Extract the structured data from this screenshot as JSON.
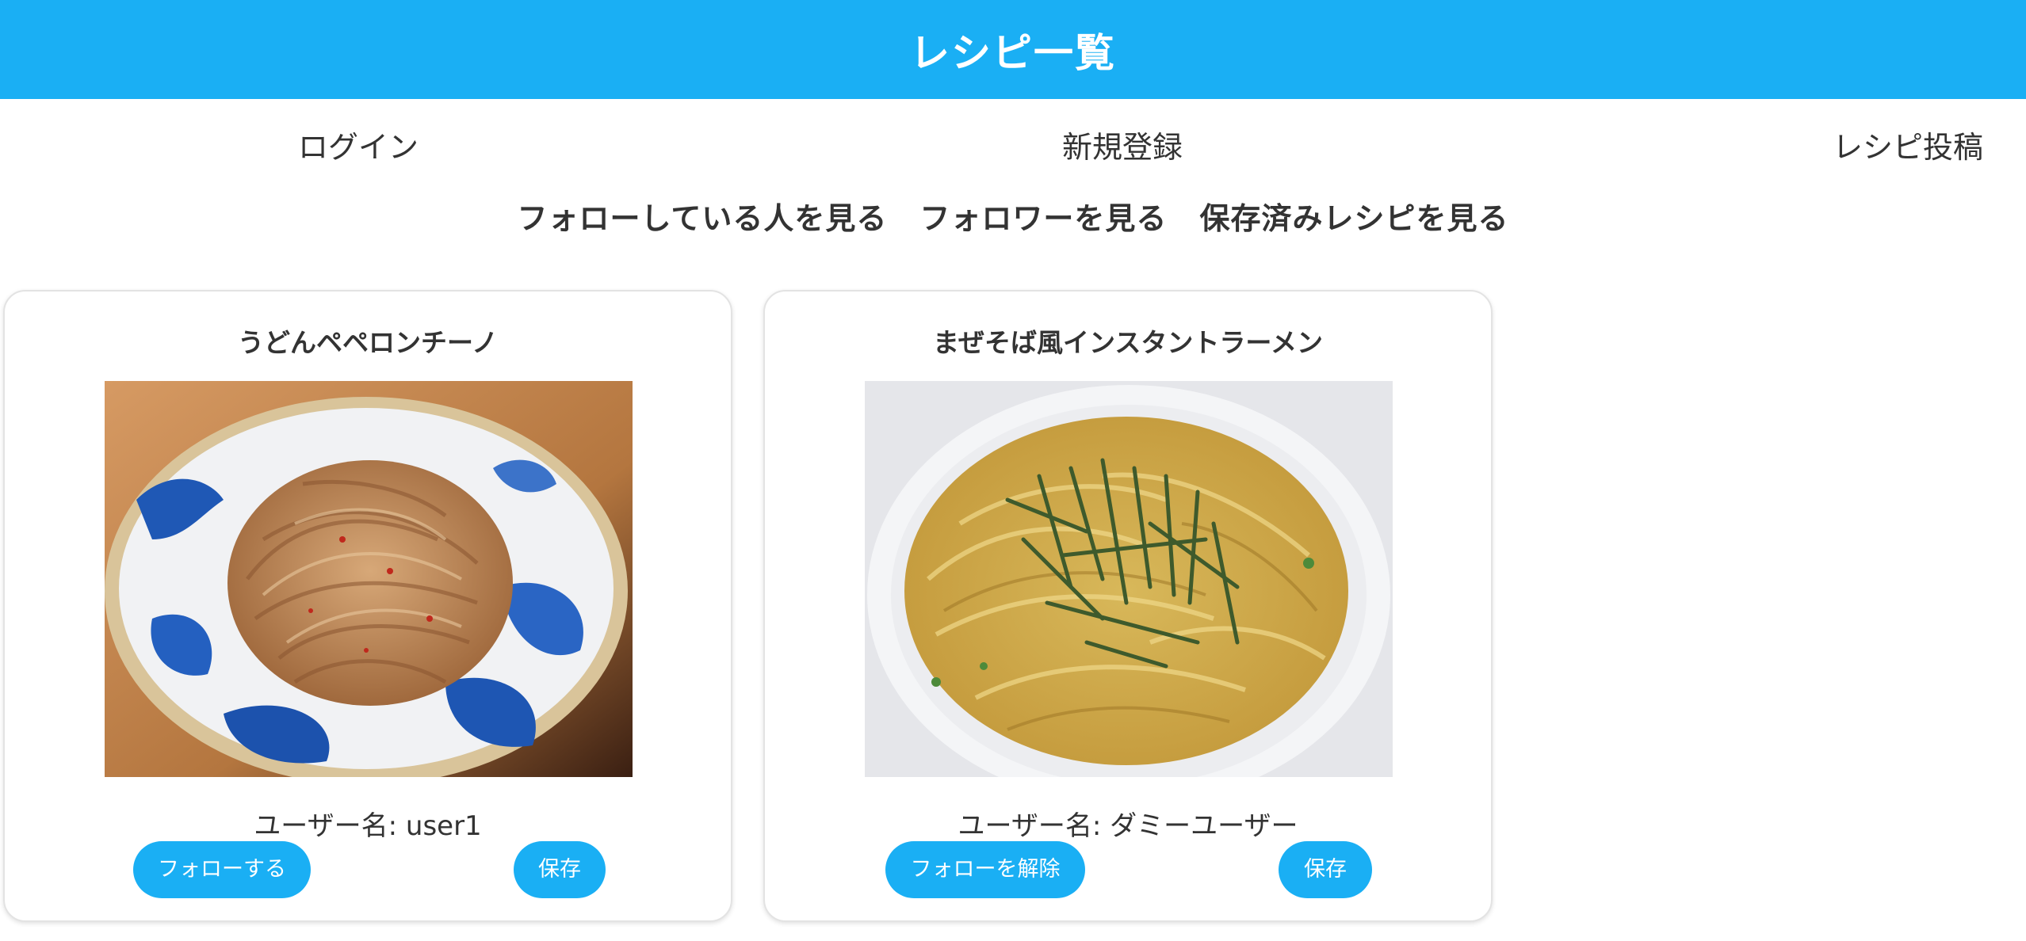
{
  "header": {
    "title": "レシピ一覧"
  },
  "nav": {
    "login": "ログイン",
    "register": "新規登録",
    "post": "レシピ投稿"
  },
  "sub_nav": {
    "following": "フォローしている人を見る",
    "followers": "フォロワーを見る",
    "saved": "保存済みレシピを見る"
  },
  "recipes": [
    {
      "title": "うどんペペロンチーノ",
      "user_label": "ユーザー名: user1",
      "follow_label": "フォローする",
      "save_label": "保存",
      "image_icon": "udon-peperoncino-photo"
    },
    {
      "title": "まぜそば風インスタントラーメン",
      "user_label": "ユーザー名: ダミーユーザー",
      "follow_label": "フォローを解除",
      "save_label": "保存",
      "image_icon": "mazesoba-ramen-photo"
    }
  ],
  "colors": {
    "accent": "#1aaff4",
    "text": "#333333",
    "background": "#ffffff"
  }
}
